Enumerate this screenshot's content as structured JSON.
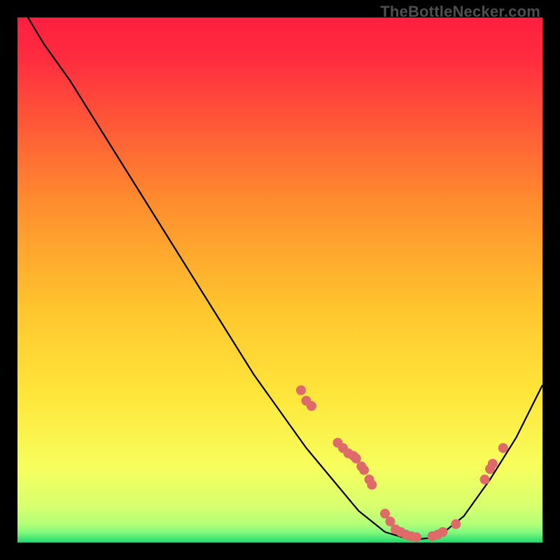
{
  "watermark": "TheBottleNecker.com",
  "chart_data": {
    "type": "line",
    "title": "",
    "xlabel": "",
    "ylabel": "",
    "xlim": [
      0,
      100
    ],
    "ylim": [
      0,
      100
    ],
    "gradient": {
      "top": "#ff1f3f",
      "mid": "#ffe63a",
      "bottom_band": "#39e67a"
    },
    "series": [
      {
        "name": "curve",
        "points": [
          {
            "x": 2,
            "y": 100
          },
          {
            "x": 5,
            "y": 95
          },
          {
            "x": 10,
            "y": 88
          },
          {
            "x": 15,
            "y": 80
          },
          {
            "x": 20,
            "y": 72
          },
          {
            "x": 25,
            "y": 64
          },
          {
            "x": 30,
            "y": 56
          },
          {
            "x": 35,
            "y": 48
          },
          {
            "x": 40,
            "y": 40
          },
          {
            "x": 45,
            "y": 32
          },
          {
            "x": 50,
            "y": 25
          },
          {
            "x": 55,
            "y": 18
          },
          {
            "x": 60,
            "y": 12
          },
          {
            "x": 65,
            "y": 6
          },
          {
            "x": 70,
            "y": 2
          },
          {
            "x": 75,
            "y": 0.5
          },
          {
            "x": 80,
            "y": 1
          },
          {
            "x": 85,
            "y": 5
          },
          {
            "x": 90,
            "y": 12
          },
          {
            "x": 95,
            "y": 20
          },
          {
            "x": 100,
            "y": 30
          }
        ]
      }
    ],
    "markers": [
      {
        "x": 54,
        "y": 29
      },
      {
        "x": 55,
        "y": 27
      },
      {
        "x": 56,
        "y": 26
      },
      {
        "x": 61,
        "y": 19
      },
      {
        "x": 62,
        "y": 18
      },
      {
        "x": 63,
        "y": 17
      },
      {
        "x": 64,
        "y": 16.5
      },
      {
        "x": 64.5,
        "y": 16
      },
      {
        "x": 65.5,
        "y": 14.5
      },
      {
        "x": 66,
        "y": 13.8
      },
      {
        "x": 67,
        "y": 12
      },
      {
        "x": 67.5,
        "y": 11
      },
      {
        "x": 70,
        "y": 5.5
      },
      {
        "x": 71,
        "y": 4
      },
      {
        "x": 72,
        "y": 2.5
      },
      {
        "x": 73,
        "y": 2
      },
      {
        "x": 74,
        "y": 1.5
      },
      {
        "x": 75,
        "y": 1.2
      },
      {
        "x": 76,
        "y": 1
      },
      {
        "x": 79,
        "y": 1.2
      },
      {
        "x": 80,
        "y": 1.5
      },
      {
        "x": 81,
        "y": 2
      },
      {
        "x": 83.5,
        "y": 3.5
      },
      {
        "x": 89,
        "y": 12
      },
      {
        "x": 90,
        "y": 14
      },
      {
        "x": 90.5,
        "y": 15
      },
      {
        "x": 92.5,
        "y": 18
      }
    ]
  }
}
